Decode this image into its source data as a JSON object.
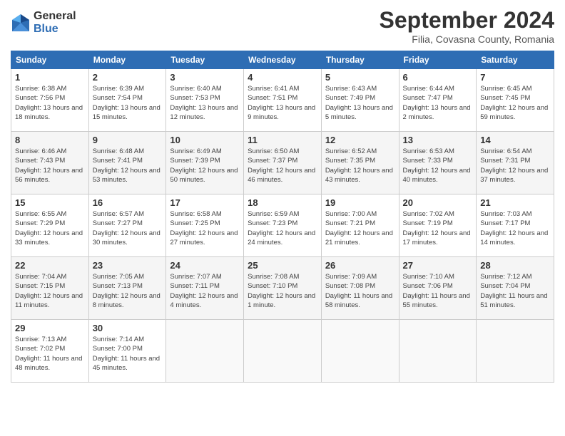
{
  "logo": {
    "general": "General",
    "blue": "Blue"
  },
  "title": "September 2024",
  "location": "Filia, Covasna County, Romania",
  "days_of_week": [
    "Sunday",
    "Monday",
    "Tuesday",
    "Wednesday",
    "Thursday",
    "Friday",
    "Saturday"
  ],
  "weeks": [
    [
      {
        "day": "1",
        "info": "Sunrise: 6:38 AM\nSunset: 7:56 PM\nDaylight: 13 hours and 18 minutes."
      },
      {
        "day": "2",
        "info": "Sunrise: 6:39 AM\nSunset: 7:54 PM\nDaylight: 13 hours and 15 minutes."
      },
      {
        "day": "3",
        "info": "Sunrise: 6:40 AM\nSunset: 7:53 PM\nDaylight: 13 hours and 12 minutes."
      },
      {
        "day": "4",
        "info": "Sunrise: 6:41 AM\nSunset: 7:51 PM\nDaylight: 13 hours and 9 minutes."
      },
      {
        "day": "5",
        "info": "Sunrise: 6:43 AM\nSunset: 7:49 PM\nDaylight: 13 hours and 5 minutes."
      },
      {
        "day": "6",
        "info": "Sunrise: 6:44 AM\nSunset: 7:47 PM\nDaylight: 13 hours and 2 minutes."
      },
      {
        "day": "7",
        "info": "Sunrise: 6:45 AM\nSunset: 7:45 PM\nDaylight: 12 hours and 59 minutes."
      }
    ],
    [
      {
        "day": "8",
        "info": "Sunrise: 6:46 AM\nSunset: 7:43 PM\nDaylight: 12 hours and 56 minutes."
      },
      {
        "day": "9",
        "info": "Sunrise: 6:48 AM\nSunset: 7:41 PM\nDaylight: 12 hours and 53 minutes."
      },
      {
        "day": "10",
        "info": "Sunrise: 6:49 AM\nSunset: 7:39 PM\nDaylight: 12 hours and 50 minutes."
      },
      {
        "day": "11",
        "info": "Sunrise: 6:50 AM\nSunset: 7:37 PM\nDaylight: 12 hours and 46 minutes."
      },
      {
        "day": "12",
        "info": "Sunrise: 6:52 AM\nSunset: 7:35 PM\nDaylight: 12 hours and 43 minutes."
      },
      {
        "day": "13",
        "info": "Sunrise: 6:53 AM\nSunset: 7:33 PM\nDaylight: 12 hours and 40 minutes."
      },
      {
        "day": "14",
        "info": "Sunrise: 6:54 AM\nSunset: 7:31 PM\nDaylight: 12 hours and 37 minutes."
      }
    ],
    [
      {
        "day": "15",
        "info": "Sunrise: 6:55 AM\nSunset: 7:29 PM\nDaylight: 12 hours and 33 minutes."
      },
      {
        "day": "16",
        "info": "Sunrise: 6:57 AM\nSunset: 7:27 PM\nDaylight: 12 hours and 30 minutes."
      },
      {
        "day": "17",
        "info": "Sunrise: 6:58 AM\nSunset: 7:25 PM\nDaylight: 12 hours and 27 minutes."
      },
      {
        "day": "18",
        "info": "Sunrise: 6:59 AM\nSunset: 7:23 PM\nDaylight: 12 hours and 24 minutes."
      },
      {
        "day": "19",
        "info": "Sunrise: 7:00 AM\nSunset: 7:21 PM\nDaylight: 12 hours and 21 minutes."
      },
      {
        "day": "20",
        "info": "Sunrise: 7:02 AM\nSunset: 7:19 PM\nDaylight: 12 hours and 17 minutes."
      },
      {
        "day": "21",
        "info": "Sunrise: 7:03 AM\nSunset: 7:17 PM\nDaylight: 12 hours and 14 minutes."
      }
    ],
    [
      {
        "day": "22",
        "info": "Sunrise: 7:04 AM\nSunset: 7:15 PM\nDaylight: 12 hours and 11 minutes."
      },
      {
        "day": "23",
        "info": "Sunrise: 7:05 AM\nSunset: 7:13 PM\nDaylight: 12 hours and 8 minutes."
      },
      {
        "day": "24",
        "info": "Sunrise: 7:07 AM\nSunset: 7:11 PM\nDaylight: 12 hours and 4 minutes."
      },
      {
        "day": "25",
        "info": "Sunrise: 7:08 AM\nSunset: 7:10 PM\nDaylight: 12 hours and 1 minute."
      },
      {
        "day": "26",
        "info": "Sunrise: 7:09 AM\nSunset: 7:08 PM\nDaylight: 11 hours and 58 minutes."
      },
      {
        "day": "27",
        "info": "Sunrise: 7:10 AM\nSunset: 7:06 PM\nDaylight: 11 hours and 55 minutes."
      },
      {
        "day": "28",
        "info": "Sunrise: 7:12 AM\nSunset: 7:04 PM\nDaylight: 11 hours and 51 minutes."
      }
    ],
    [
      {
        "day": "29",
        "info": "Sunrise: 7:13 AM\nSunset: 7:02 PM\nDaylight: 11 hours and 48 minutes."
      },
      {
        "day": "30",
        "info": "Sunrise: 7:14 AM\nSunset: 7:00 PM\nDaylight: 11 hours and 45 minutes."
      },
      {
        "day": "",
        "info": ""
      },
      {
        "day": "",
        "info": ""
      },
      {
        "day": "",
        "info": ""
      },
      {
        "day": "",
        "info": ""
      },
      {
        "day": "",
        "info": ""
      }
    ]
  ]
}
